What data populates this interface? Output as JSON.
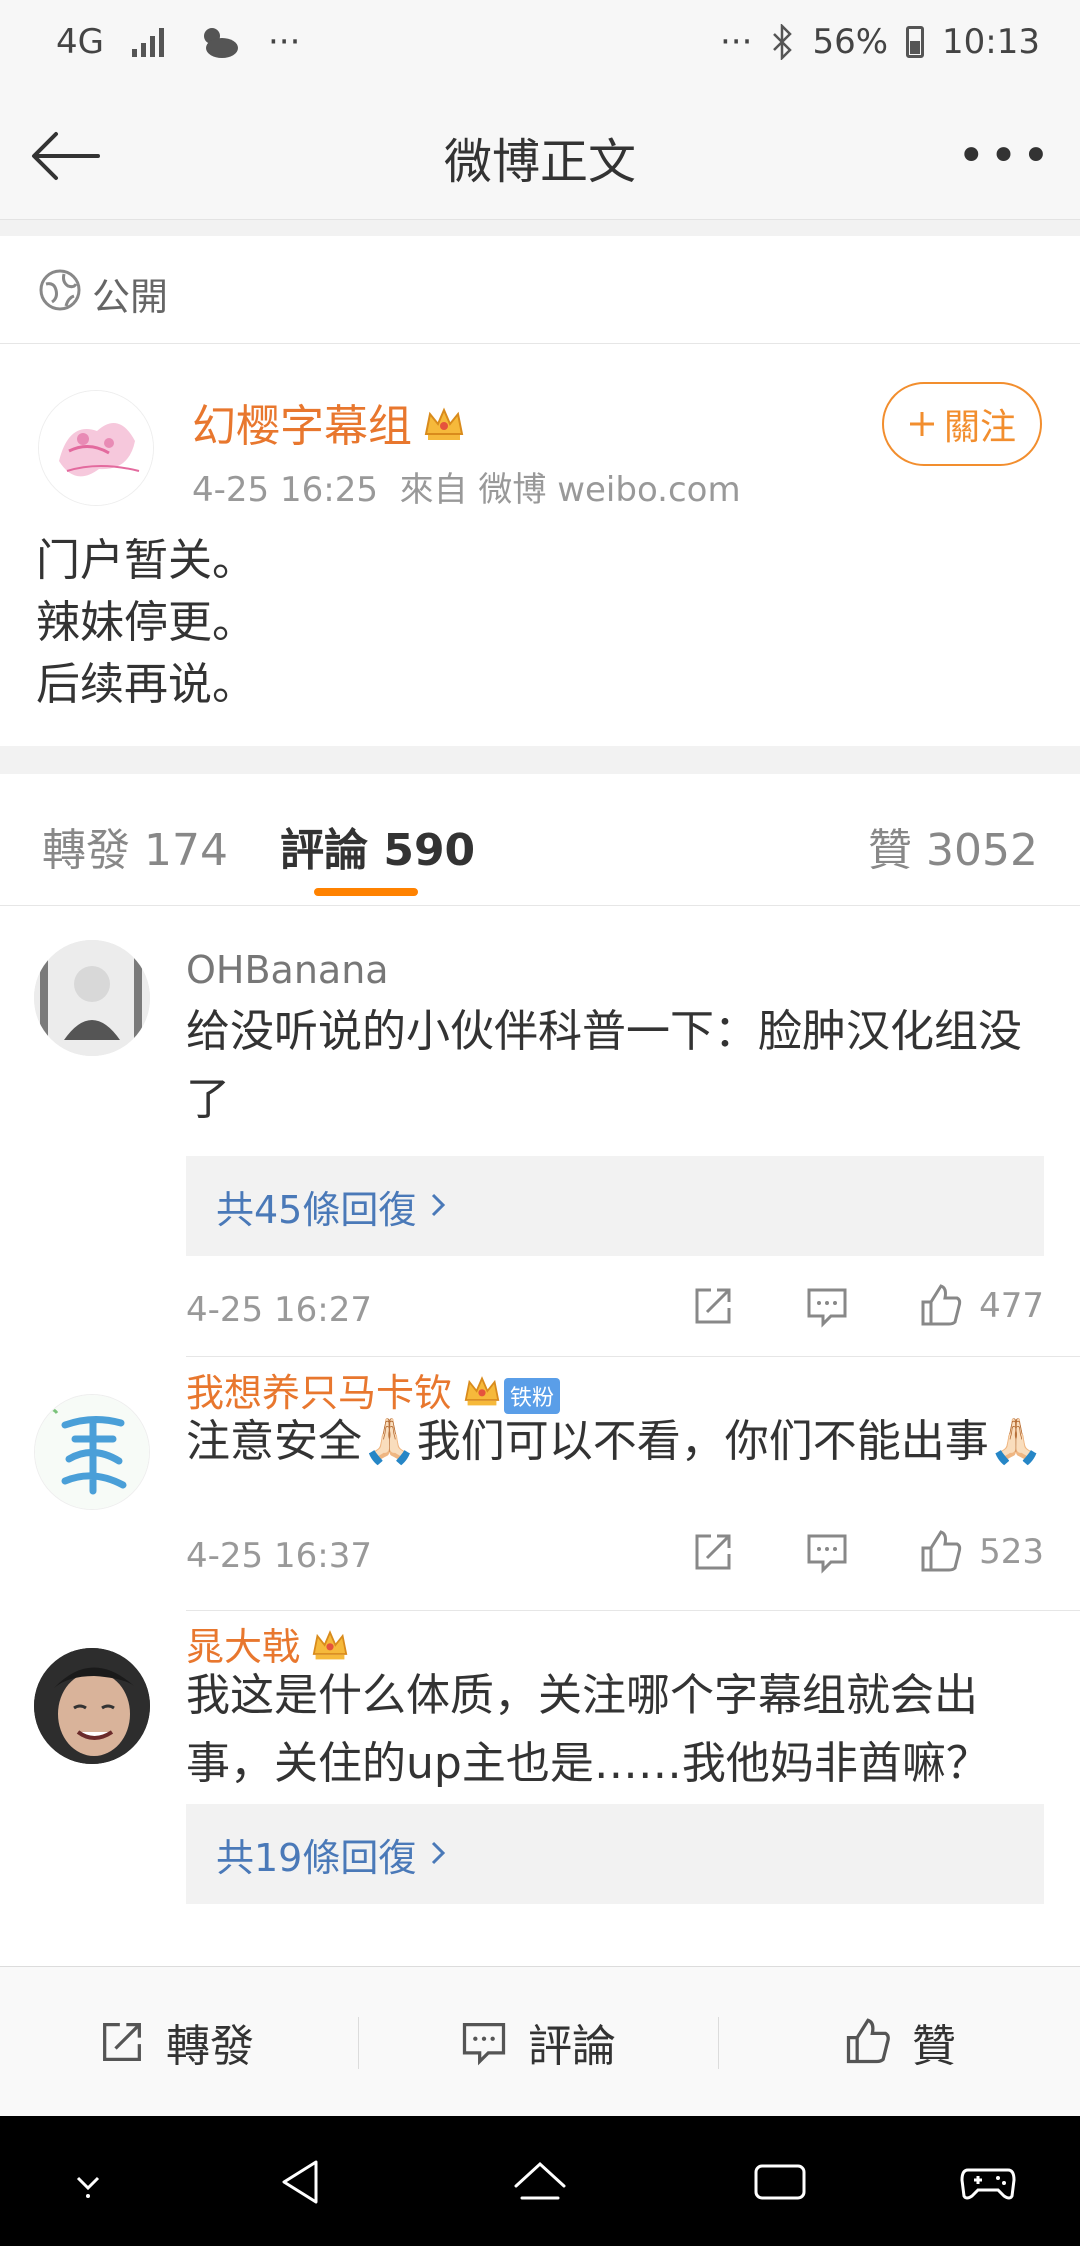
{
  "status_bar": {
    "network": "4G",
    "extra_left": "···",
    "extra_right": "···",
    "battery": "56%",
    "time": "10:13"
  },
  "nav": {
    "title": "微博正文",
    "more": "•••"
  },
  "privacy": {
    "label": "公開"
  },
  "post": {
    "username": "幻樱字幕组",
    "time": "4-25 16:25",
    "source": "來自 微博 weibo.com",
    "follow_label": "關注",
    "lines": [
      "门户暂关。",
      "辣妹停更。",
      "后续再说。"
    ]
  },
  "tabs": {
    "repost": "轉發 174",
    "comment_label": "評論",
    "comment_count": "590",
    "likes": "贊 3052"
  },
  "comments": [
    {
      "name": "OHBanana",
      "text": "给没听说的小伙伴科普一下：脸肿汉化组没了",
      "replies": "共45條回復",
      "time": "4-25 16:27",
      "likes": "477"
    },
    {
      "name": "我想养只马卡钦",
      "badge": "铁粉",
      "text": "注意安全🙏🏻我们可以不看，你们不能出事🙏🏻",
      "time": "4-25 16:37",
      "likes": "523"
    },
    {
      "name": "晁大戟",
      "text": "我这是什么体质，关注哪个字幕组就会出事，关住的up主也是……我他妈非酋嘛？",
      "replies": "共19條回復"
    }
  ],
  "bottom_bar": {
    "repost": "轉發",
    "comment": "評論",
    "like": "贊"
  },
  "colors": {
    "accent_orange": "#ff8200",
    "username_orange": "#e8772e",
    "link_blue": "#4a79b8"
  }
}
